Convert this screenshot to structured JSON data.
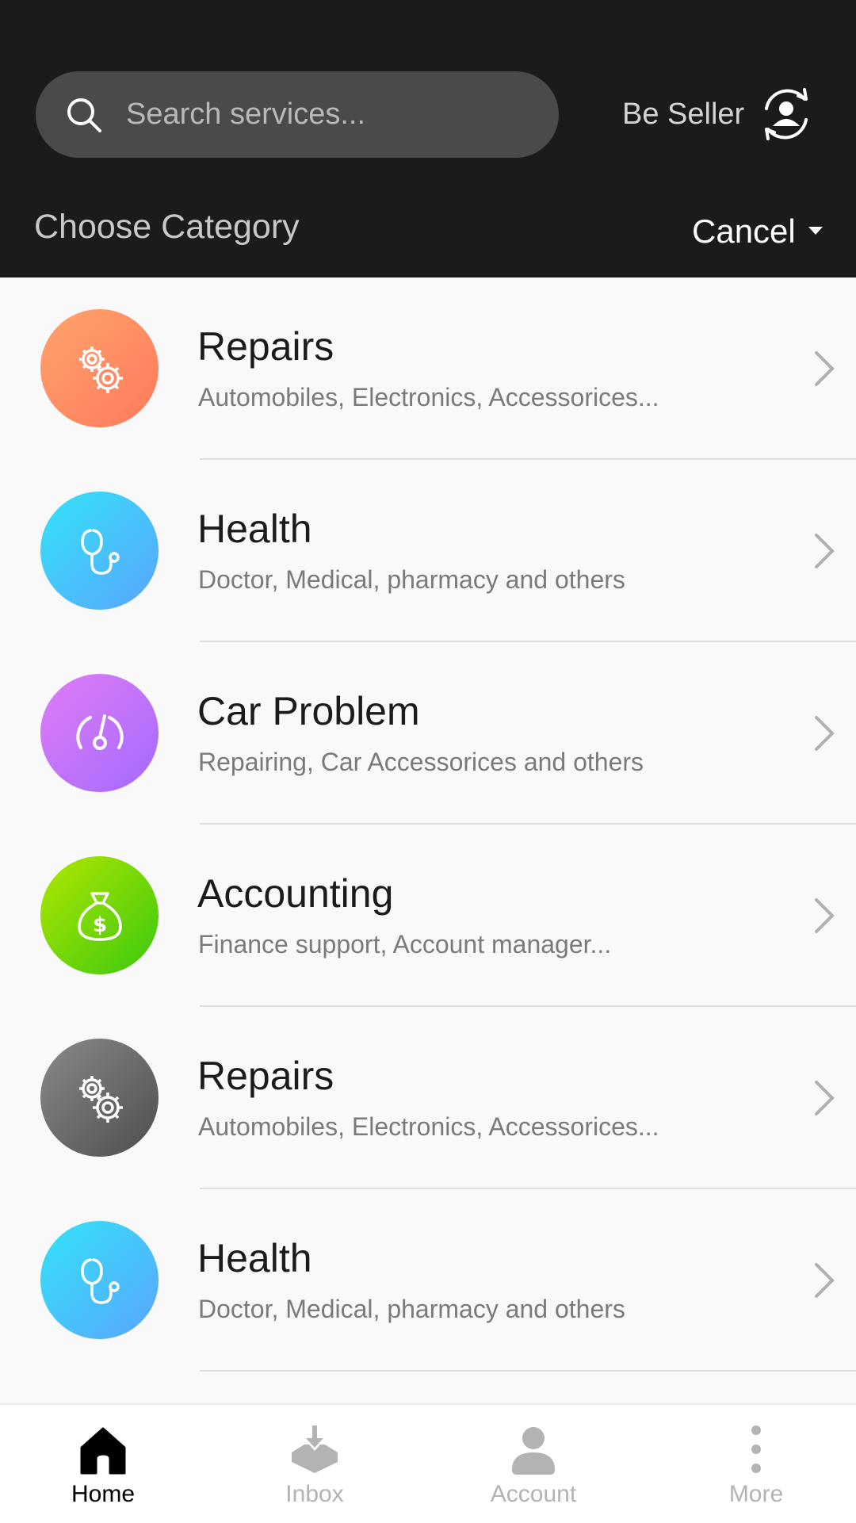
{
  "header": {
    "search": {
      "placeholder": "Search services...",
      "value": ""
    },
    "be_seller_label": "Be Seller",
    "choose_category_label": "Choose Category",
    "cancel_label": "Cancel"
  },
  "categories": [
    {
      "title": "Repairs",
      "subtitle": "Automobiles, Electronics, Accessorices...",
      "icon": "gears-icon",
      "gradient": [
        "#ffa36b",
        "#ff7a5c"
      ]
    },
    {
      "title": "Health",
      "subtitle": "Doctor, Medical, pharmacy and others",
      "icon": "stethoscope-icon",
      "gradient": [
        "#33e3f7",
        "#5aa5ff"
      ]
    },
    {
      "title": "Car Problem",
      "subtitle": "Repairing, Car Accessorices and others",
      "icon": "speedometer-icon",
      "gradient": [
        "#e07cf5",
        "#a36bff"
      ]
    },
    {
      "title": "Accounting",
      "subtitle": "Finance support, Account manager...",
      "icon": "money-bag-icon",
      "gradient": [
        "#b3e600",
        "#3ac80f"
      ]
    },
    {
      "title": "Repairs",
      "subtitle": "Automobiles, Electronics, Accessorices...",
      "icon": "gears-icon",
      "gradient": [
        "#8a8a8a",
        "#4e4e4e"
      ]
    },
    {
      "title": "Health",
      "subtitle": "Doctor, Medical, pharmacy and others",
      "icon": "stethoscope-icon",
      "gradient": [
        "#33e3f7",
        "#5aa5ff"
      ]
    }
  ],
  "bottom_nav": [
    {
      "label": "Home",
      "icon": "home-icon",
      "active": true
    },
    {
      "label": "Inbox",
      "icon": "inbox-icon",
      "active": false
    },
    {
      "label": "Account",
      "icon": "account-icon",
      "active": false
    },
    {
      "label": "More",
      "icon": "more-icon",
      "active": false
    }
  ],
  "colors": {
    "header_bg": "#1b1b1c",
    "search_bg": "#4a4a4a",
    "list_bg": "#f9f9f9",
    "nav_active": "#000000",
    "nav_inactive": "#b3b3b3"
  }
}
